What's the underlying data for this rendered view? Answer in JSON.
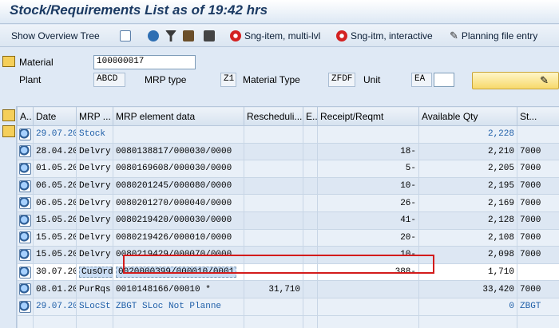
{
  "title": "Stock/Requirements List as of 19:42 hrs",
  "toolbar": {
    "show_overview_tree": "Show Overview Tree",
    "sng_item_multi": "Sng-item, multi-lvl",
    "sng_item_interactive": "Sng-itm, interactive",
    "planning_file_entry": "Planning file entry"
  },
  "header": {
    "material_label": "Material",
    "material_value": "100000017",
    "plant_label": "Plant",
    "plant_value": "ABCD",
    "mrp_type_label": "MRP type",
    "mrp_type_value": "Z1",
    "material_type_label": "Material Type",
    "material_type_value": "ZFDF",
    "unit_label": "Unit",
    "unit_value": "EA"
  },
  "columns": [
    "A..",
    "Date",
    "MRP ...",
    "MRP element data",
    "Rescheduli...",
    "E..",
    "Receipt/Reqmt",
    "Available Qty",
    "St..."
  ],
  "rows": [
    {
      "date": "29.07.2014",
      "mrp": "Stock",
      "data": "",
      "resched": "",
      "e": "",
      "receipt": "",
      "avail": "2,228",
      "st": ""
    },
    {
      "date": "28.04.2014",
      "mrp": "Delvry",
      "data": "0080138817/000030/0000",
      "resched": "",
      "e": "",
      "receipt": "18-",
      "avail": "2,210",
      "st": "7000"
    },
    {
      "date": "01.05.2014",
      "mrp": "Delvry",
      "data": "0080169608/000030/0000",
      "resched": "",
      "e": "",
      "receipt": "5-",
      "avail": "2,205",
      "st": "7000"
    },
    {
      "date": "06.05.2014",
      "mrp": "Delvry",
      "data": "0080201245/000080/0000",
      "resched": "",
      "e": "",
      "receipt": "10-",
      "avail": "2,195",
      "st": "7000"
    },
    {
      "date": "06.05.2014",
      "mrp": "Delvry",
      "data": "0080201270/000040/0000",
      "resched": "",
      "e": "",
      "receipt": "26-",
      "avail": "2,169",
      "st": "7000"
    },
    {
      "date": "15.05.2014",
      "mrp": "Delvry",
      "data": "0080219420/000030/0000",
      "resched": "",
      "e": "",
      "receipt": "41-",
      "avail": "2,128",
      "st": "7000"
    },
    {
      "date": "15.05.2014",
      "mrp": "Delvry",
      "data": "0080219426/000010/0000",
      "resched": "",
      "e": "",
      "receipt": "20-",
      "avail": "2,108",
      "st": "7000"
    },
    {
      "date": "15.05.2014",
      "mrp": "Delvry",
      "data": "0080219429/000070/0000",
      "resched": "",
      "e": "",
      "receipt": "10-",
      "avail": "2,098",
      "st": "7000"
    },
    {
      "date": "30.07.2014",
      "mrp": "CusOrd",
      "data": "0020000399/000010/0001",
      "resched": "",
      "e": "",
      "receipt": "388-",
      "avail": "1,710",
      "st": ""
    },
    {
      "date": "08.01.2015",
      "mrp": "PurRqs",
      "data": "0010148166/00010 *",
      "resched": "31,710",
      "e": "",
      "receipt": "",
      "avail": "33,420",
      "st": "7000"
    },
    {
      "date": "29.07.2014",
      "mrp": "SLocSt",
      "data": "ZBGT SLoc Not Planne",
      "resched": "",
      "e": "",
      "receipt": "",
      "avail": "0",
      "st": "ZBGT"
    }
  ]
}
